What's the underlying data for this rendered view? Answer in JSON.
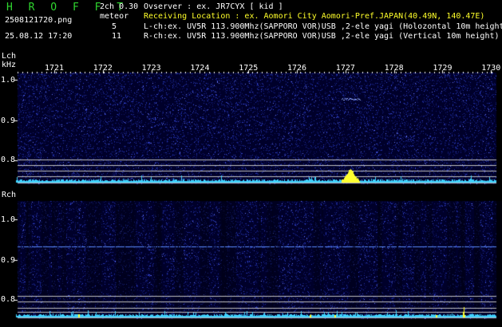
{
  "header": {
    "app_title": "H R O F F T",
    "version": "2ch 0.30",
    "filename": "2508121720.png",
    "meteor_label": "meteor",
    "lch_count": "5",
    "rch_count": "11",
    "datetime": "25.08.12 17:20",
    "info_lines": [
      "Ovserver          : ex. JR7CYX [ kid ]",
      "Receiving Location : ex. Aomori City Aomori-Pref.JAPAN(40.49N, 140.47E)",
      "L-ch:ex. UV5R 113.900Mhz(SAPPORO VOR)USB ,2-ele yagi (Holozontal 10m height)",
      "R-ch:ex. UV5R 113.900Mhz(SAPPORO VOR)USB ,2-ele yagi (Vertical 10m height)"
    ]
  },
  "time_axis": {
    "labels": [
      "1721",
      "1722",
      "1723",
      "1724",
      "1725",
      "1726",
      "1727",
      "1728",
      "1729",
      "1730"
    ]
  },
  "lch": {
    "label": "Lch",
    "unit": "kHz",
    "ticks": [
      "1.0",
      "0.9",
      "0.8"
    ]
  },
  "rch": {
    "label": "Rch",
    "ticks": [
      "1.0",
      "0.9",
      "0.8"
    ]
  },
  "colors": {
    "title": "#2fd62f",
    "text": "#ffffff",
    "highlight": "#ffff2a",
    "spectrum_base": "#000044",
    "trace": "#3fd3ff",
    "signal": "#ffff30"
  }
}
